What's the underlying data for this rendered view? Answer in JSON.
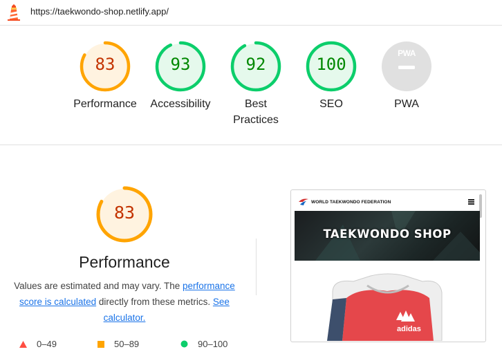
{
  "browser": {
    "url": "https://taekwondo-shop.netlify.app/"
  },
  "gauges": [
    {
      "score": "83",
      "label": "Performance",
      "rating": "average",
      "fraction": 0.83
    },
    {
      "score": "93",
      "label": "Accessibility",
      "rating": "pass",
      "fraction": 0.93
    },
    {
      "score": "92",
      "label": "Best Practices",
      "rating": "pass",
      "fraction": 0.92
    },
    {
      "score": "100",
      "label": "SEO",
      "rating": "pass",
      "fraction": 1.0
    },
    {
      "score": "",
      "label": "PWA",
      "rating": "na",
      "badge": "PWA"
    }
  ],
  "performance": {
    "score": "83",
    "fraction": 0.83,
    "title": "Performance",
    "desc_before": "Values are estimated and may vary. The ",
    "link_score": "performance score is calculated",
    "desc_middle": " directly from these metrics. ",
    "link_calc": "See calculator."
  },
  "legend": [
    {
      "range": "0–49",
      "shape": "triangle",
      "color": "#ff4e42"
    },
    {
      "range": "50–89",
      "shape": "square",
      "color": "#ffa400"
    },
    {
      "range": "90–100",
      "shape": "circle",
      "color": "#0cce6b"
    }
  ],
  "screenshot": {
    "org": "WORLD TAEKWONDO FEDERATION",
    "banner": "TAEKWONDO SHOP",
    "product_brand": "adidas"
  },
  "colors": {
    "average": "#ffa400",
    "average_text": "#c33300",
    "average_bg": "#fff3e0",
    "pass": "#0cce6b",
    "pass_text": "#008800",
    "pass_bg": "#e5f9ec",
    "na": "#cccccc",
    "na_bg": "#e0e0e0"
  }
}
